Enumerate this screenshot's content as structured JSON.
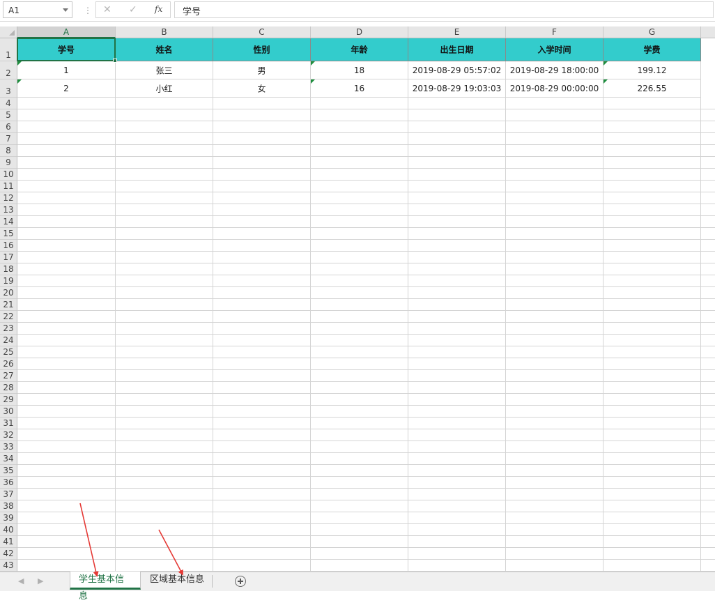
{
  "formula_bar": {
    "name_box": "A1",
    "separator": "⋮",
    "cancel_icon": "✕",
    "enter_icon": "✓",
    "fx_label": "fx",
    "content": "学号"
  },
  "columns": [
    "A",
    "B",
    "C",
    "D",
    "E",
    "F",
    "G"
  ],
  "row_numbers": [
    "1",
    "2",
    "3",
    "4",
    "5",
    "6",
    "7",
    "8",
    "9",
    "10",
    "11",
    "12",
    "13",
    "14",
    "15",
    "16",
    "17",
    "18",
    "19",
    "20",
    "21",
    "22",
    "23",
    "24",
    "25",
    "26",
    "27",
    "28",
    "29",
    "30",
    "31",
    "32",
    "33",
    "34",
    "35",
    "36",
    "37",
    "38",
    "39",
    "40",
    "41",
    "42",
    "43"
  ],
  "table": {
    "headers": [
      "学号",
      "姓名",
      "性别",
      "年龄",
      "出生日期",
      "入学时间",
      "学费"
    ],
    "rows": [
      [
        "1",
        "张三",
        "男",
        "18",
        "2019-08-29 05:57:02",
        "2019-08-29 18:00:00",
        "199.12"
      ],
      [
        "2",
        "小红",
        "女",
        "16",
        "2019-08-29 19:03:03",
        "2019-08-29 00:00:00",
        "226.55"
      ]
    ]
  },
  "colors": {
    "header_fill": "#33cccc",
    "accent": "#217346",
    "annotation_arrow": "#e53935",
    "number_as_text_marker": "#1e8e3e"
  },
  "sheet_tabs": {
    "nav_prev_icon": "◀",
    "nav_next_icon": "▶",
    "tabs": [
      {
        "label": "学生基本信息",
        "active": true
      },
      {
        "label": "区域基本信息",
        "active": false
      }
    ],
    "add_icon": "plus-circle-icon"
  }
}
